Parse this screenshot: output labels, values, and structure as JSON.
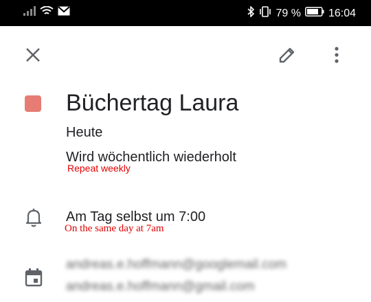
{
  "status_bar": {
    "battery_percent": "79 %",
    "time": "16:04",
    "icons_left": [
      "signal-icon",
      "wifi-icon",
      "gmail-icon"
    ],
    "icons_right": [
      "bluetooth-icon",
      "vibrate-icon",
      "battery-icon"
    ]
  },
  "toolbar": {
    "close_icon": "close-icon",
    "edit_icon": "edit-pencil-icon",
    "more_icon": "more-vert-icon"
  },
  "event": {
    "color": "#e67c73",
    "title": "Büchertag Laura",
    "date": "Heute",
    "recurrence": "Wird wöchentlich wiederholt",
    "recurrence_annotation": "Repeat weekly",
    "reminder": "Am Tag selbst um 7:00",
    "reminder_annotation": "On the same day at 7am",
    "calendar_line1": "andreas.e.hoffmann@googlemail.com",
    "calendar_line2": "andreas.e.hoffmann@gmail.com"
  }
}
